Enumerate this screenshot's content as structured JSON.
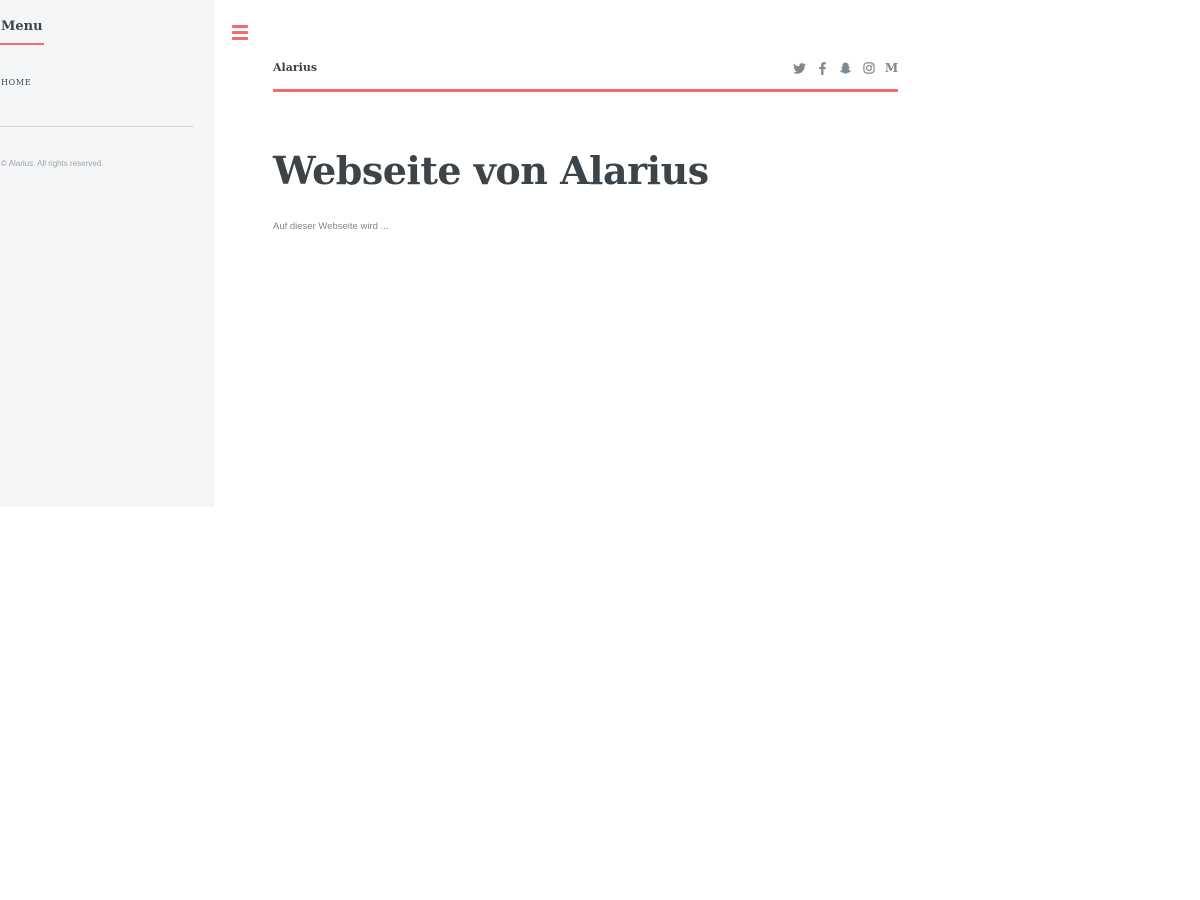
{
  "sidebar": {
    "menu_title": "Menu",
    "nav_items": [
      {
        "label": "HOME"
      }
    ],
    "copyright": "© Alarius. All rights reserved."
  },
  "header": {
    "site_name": "Alarius",
    "social_icons": [
      "twitter-icon",
      "facebook-icon",
      "snapchat-icon",
      "instagram-icon",
      "medium-icon"
    ],
    "medium_letter": "M"
  },
  "main": {
    "title": "Webseite von Alarius",
    "intro": "Auf dieser Webseite wird ..."
  },
  "colors": {
    "accent": "#f56a6a",
    "heading": "#3d4449",
    "text_muted": "#7f888f",
    "sidebar_bg": "#f5f6f7"
  }
}
